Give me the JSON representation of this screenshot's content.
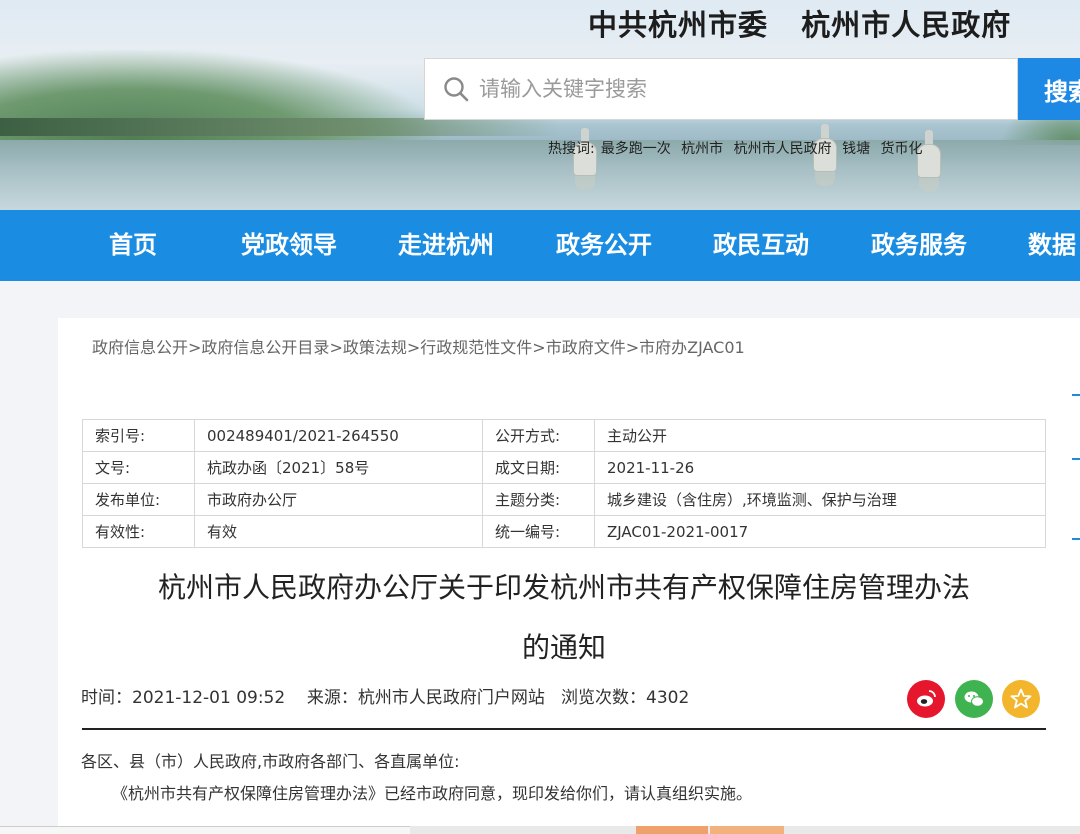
{
  "header": {
    "site_title": "中共杭州市委   杭州市人民政府",
    "search": {
      "placeholder": "请输入关键字搜索",
      "button_label": "搜索"
    },
    "hot_words_label": "热搜词:",
    "hot_words": [
      "最多跑一次",
      "杭州市",
      "杭州市人民政府",
      "钱塘",
      "货币化"
    ]
  },
  "nav": {
    "items": [
      "首页",
      "党政领导",
      "走进杭州",
      "政务公开",
      "政民互动",
      "政务服务",
      "数据"
    ]
  },
  "breadcrumb": [
    "政府信息公开",
    "政府信息公开目录",
    "政策法规",
    "行政规范性文件",
    "市政府文件",
    "市府办ZJAC01"
  ],
  "breadcrumb_separator": ">",
  "meta_table": {
    "rows": [
      {
        "k1": "索引号:",
        "v1": "002489401/2021-264550",
        "k2": "公开方式:",
        "v2": "主动公开"
      },
      {
        "k1": "文号:",
        "v1": "杭政办函〔2021〕58号",
        "k2": "成文日期:",
        "v2": "2021-11-26"
      },
      {
        "k1": "发布单位:",
        "v1": "市政府办公厅",
        "k2": "主题分类:",
        "v2": "城乡建设（含住房）,环境监测、保护与治理"
      },
      {
        "k1": "有效性:",
        "v1": "有效",
        "k2": "统一编号:",
        "v2": "ZJAC01-2021-0017"
      }
    ]
  },
  "document": {
    "title_line1": "杭州市人民政府办公厅关于印发杭州市共有产权保障住房管理办法",
    "title_line2": "的通知",
    "time_label": "时间：",
    "time_value": "2021-12-01 09:52",
    "source_label": "来源：",
    "source_value": "杭州市人民政府门户网站",
    "views_label": "浏览次数：",
    "views_value": "4302",
    "body_line1": "各区、县（市）人民政府,市政府各部门、各直属单位:",
    "body_line2": "《杭州市共有产权保障住房管理办法》已经市政府同意，现印发给你们，请认真组织实施。"
  },
  "share_icons": [
    "weibo-icon",
    "wechat-icon",
    "star-icon"
  ],
  "colors": {
    "nav_blue": "#1a8de3",
    "search_button": "#1e88e5",
    "weibo_red": "#e6162d",
    "wechat_green": "#3fb34f",
    "favorite_yellow": "#f3b52b"
  }
}
